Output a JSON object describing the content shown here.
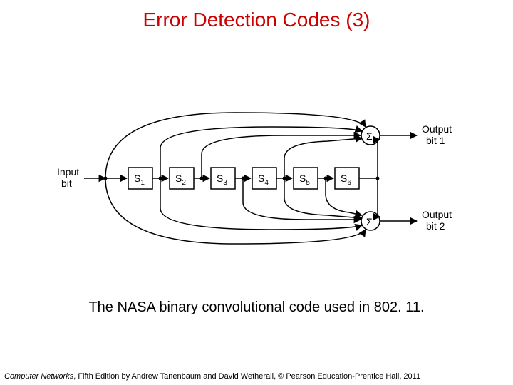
{
  "title": "Error Detection Codes (3)",
  "caption": "The NASA binary convolutional code used in 802. 11.",
  "footer": {
    "book": "Computer Networks",
    "rest": ", Fifth Edition by Andrew Tanenbaum and David Wetherall, © Pearson Education-Prentice Hall, 2011"
  },
  "diagram": {
    "input_label_l1": "Input",
    "input_label_l2": "bit",
    "out1_l1": "Output",
    "out1_l2": "bit 1",
    "out2_l1": "Output",
    "out2_l2": "bit 2",
    "shift": [
      "S",
      "S",
      "S",
      "S",
      "S",
      "S"
    ],
    "shift_sub": [
      "1",
      "2",
      "3",
      "4",
      "5",
      "6"
    ],
    "sum": "Σ"
  }
}
